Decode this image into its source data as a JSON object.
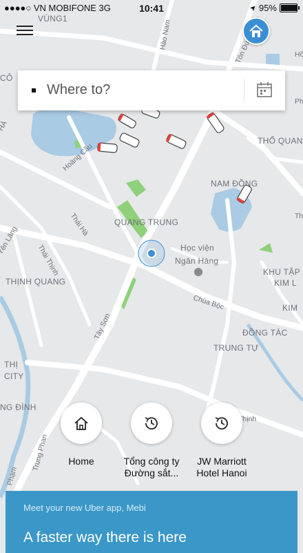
{
  "status_bar": {
    "carrier": "●●●●○ VN MOBIFONE  3G",
    "time": "10:41",
    "location_arrow": "➤",
    "battery": "95%",
    "battery_level": 0.95
  },
  "menu": {
    "icon": "hamburger-menu-icon"
  },
  "home_badge": {
    "icon": "house-icon",
    "color": "#3b8ed3"
  },
  "search": {
    "placeholder": "Where to?",
    "schedule_icon": "calendar-icon"
  },
  "map": {
    "areas": [
      "VÙNG1",
      "CÔ",
      "HÀ",
      "QUANG TRUNG",
      "NAM ĐỒNG",
      "THỔ QUAN",
      "THỊNH QUANG",
      "KHU TẬP",
      "KIM L",
      "KIM",
      "ĐỒNG TÁC",
      "TRUNG TỰ",
      "THỊ",
      "CITY",
      "NG ĐÌNH"
    ],
    "roads": [
      "Hào Nam",
      "Tôn Đức Thắng",
      "Hoàng Cầu",
      "Thái Hà",
      "Thái Thịnh",
      "Yên Lãng",
      "Tây Sơn",
      "Chùa Bộc",
      "Thịnh",
      "Trung Phan",
      "Phạm",
      "Hồ",
      "Phố",
      "Thư"
    ],
    "poi": [
      "Học viện",
      "Ngân Hàng"
    ],
    "user_location_color": "#3a8fd6"
  },
  "shortcuts": [
    {
      "icon": "home-icon",
      "label_line1": "Home",
      "label_line2": ""
    },
    {
      "icon": "history-clock-icon",
      "label_line1": "Tổng công ty",
      "label_line2": "Đường sắt..."
    },
    {
      "icon": "history-clock-icon",
      "label_line1": "JW Marriott",
      "label_line2": "Hotel Hanoi"
    }
  ],
  "promo": {
    "subtitle": "Meet your new Uber app, Mebi",
    "title": "A faster way there is here",
    "color": "#3a97c8"
  }
}
